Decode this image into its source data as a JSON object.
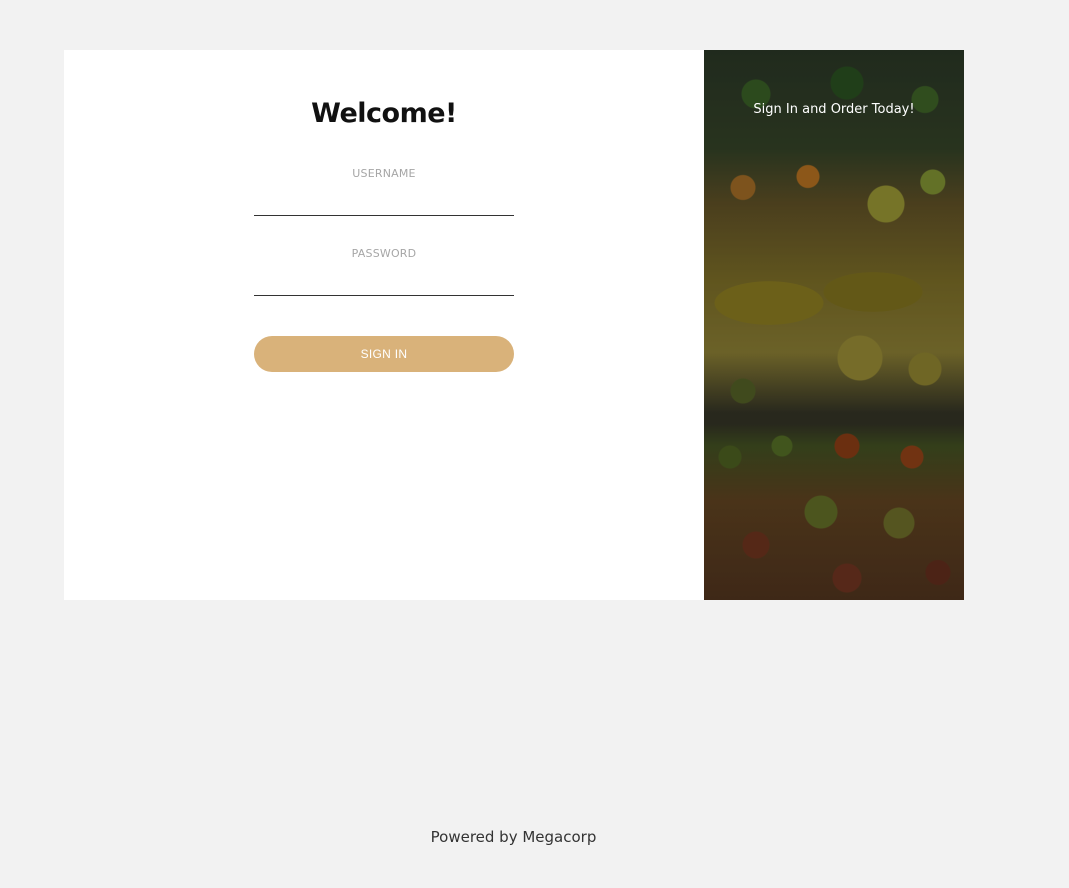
{
  "login": {
    "title": "Welcome!",
    "username_label": "USERNAME",
    "username_value": "",
    "password_label": "PASSWORD",
    "password_value": "",
    "signin_label": "SIGN IN"
  },
  "promo": {
    "text": "Sign In and Order Today!"
  },
  "footer": {
    "text": "Powered by Megacorp"
  },
  "colors": {
    "page_background": "#f2f2f2",
    "button": "#d9b27a"
  }
}
